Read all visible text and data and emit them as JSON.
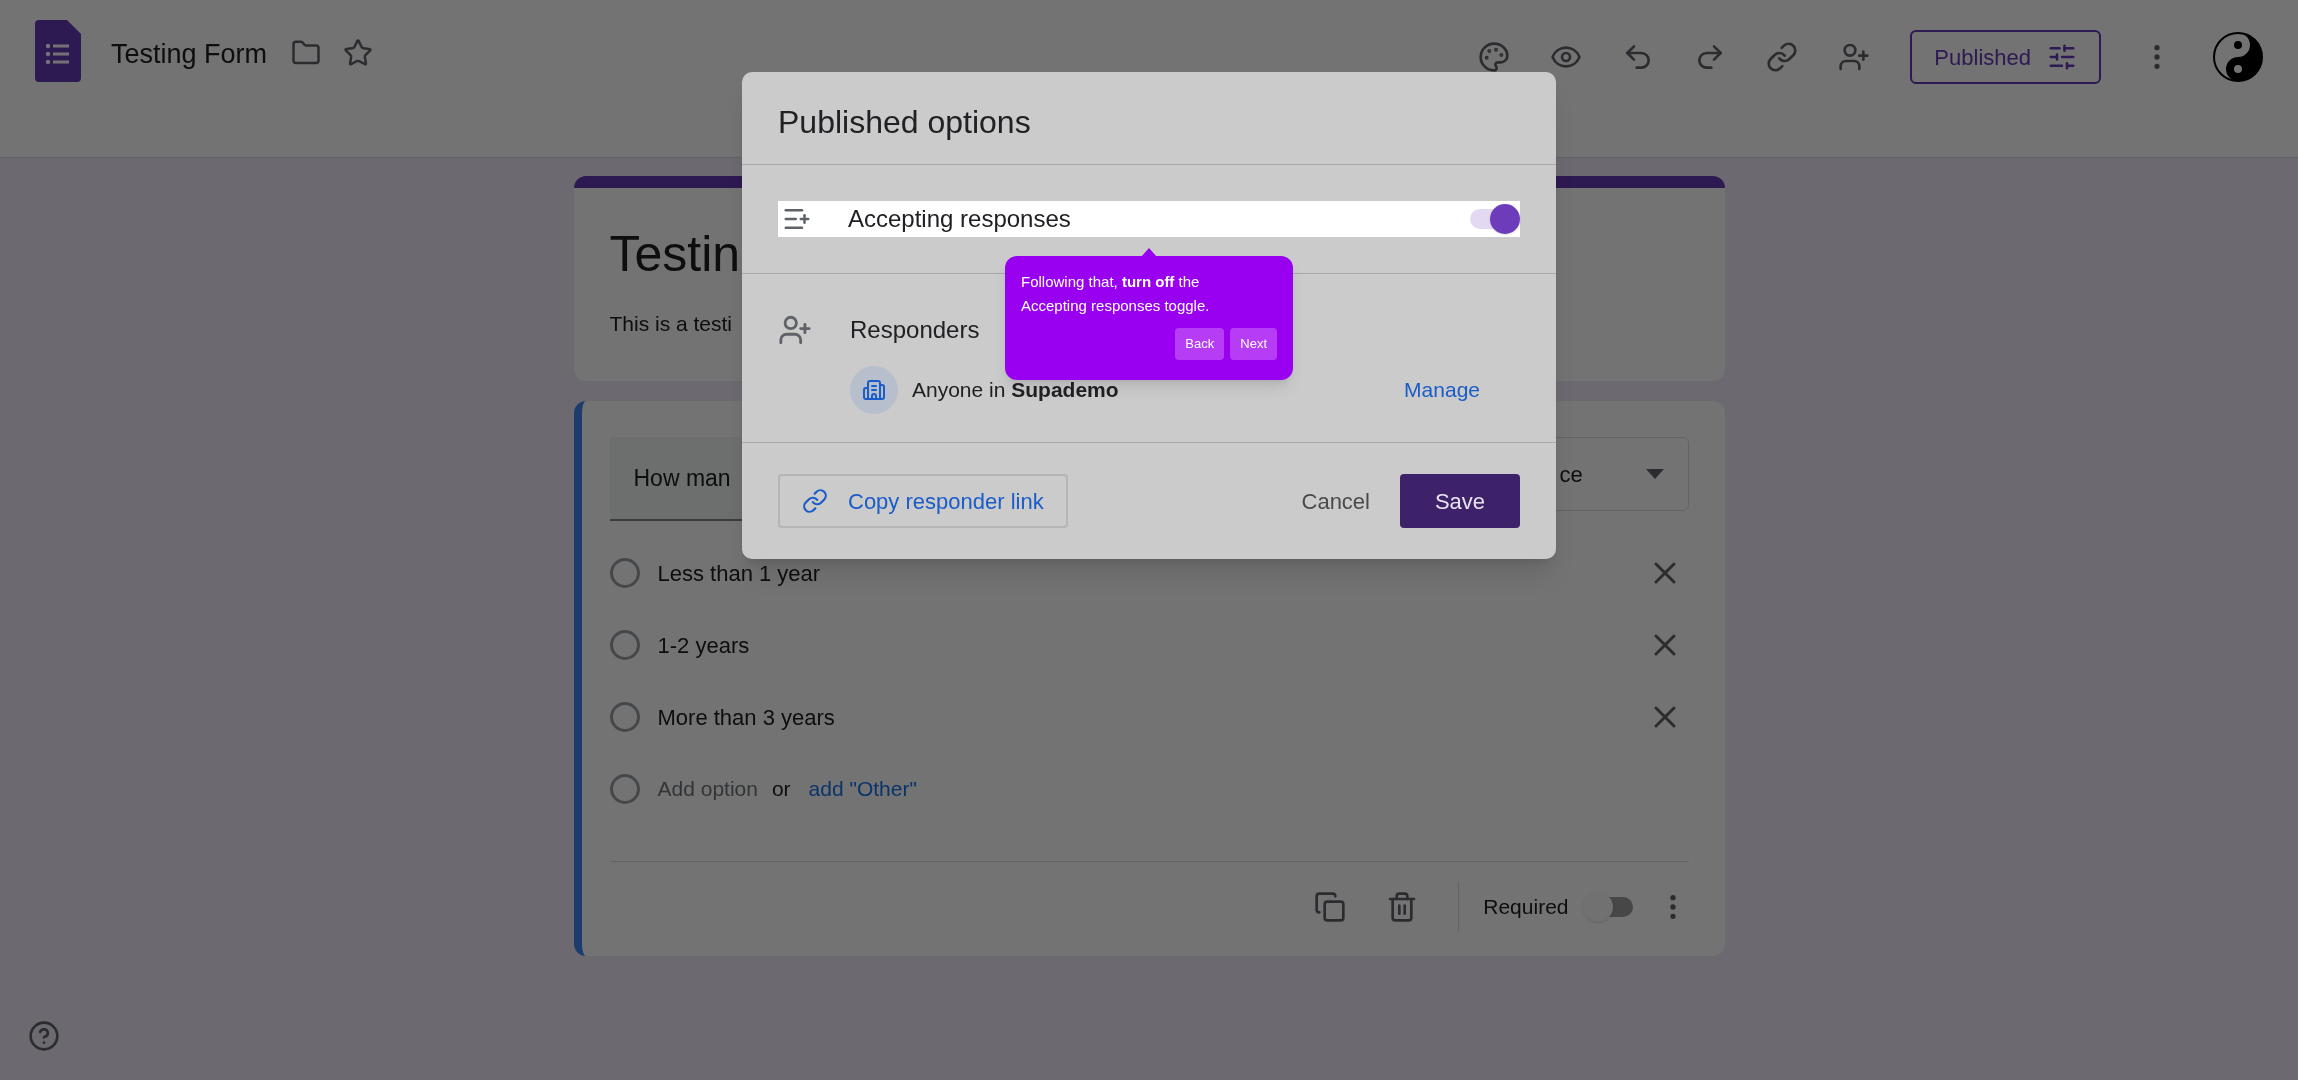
{
  "header": {
    "title": "Testing Form",
    "published_button": "Published"
  },
  "form": {
    "title_card": {
      "title": "Testin",
      "description": "This is a testi"
    },
    "question": {
      "text": "How man",
      "type_dropdown": "ce",
      "options": [
        {
          "label": "Less than 1 year"
        },
        {
          "label": "1-2 years"
        },
        {
          "label": "More than 3 years"
        }
      ],
      "add_option": {
        "label": "Add option",
        "or": "or",
        "other_link": "add \"Other\""
      },
      "required": {
        "label": "Required",
        "on": false
      }
    }
  },
  "dialog": {
    "title": "Published options",
    "accepting": {
      "label": "Accepting responses",
      "on": true
    },
    "responders": {
      "heading": "Responders",
      "audience": "Anyone in **Supademo**",
      "manage": "Manage"
    },
    "copy_link": "Copy responder link",
    "cancel": "Cancel",
    "save": "Save"
  },
  "tour_tip": {
    "text": "Following that, **turn off** the Accepting responses toggle.",
    "buttons": [
      "Back",
      "Next"
    ]
  }
}
